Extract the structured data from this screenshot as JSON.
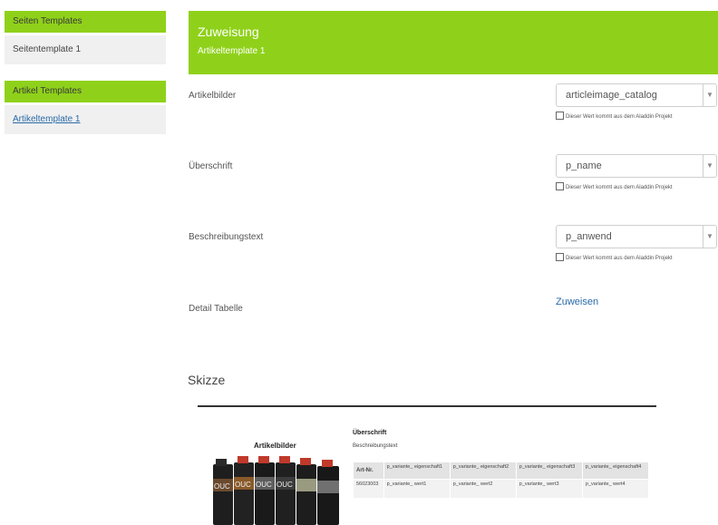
{
  "sidebar": {
    "page_templates_header": "Seiten Templates",
    "page_templates_item": "Seitentemplate 1",
    "article_templates_header": "Artikel Templates",
    "article_templates_item": "Artikeltemplate 1"
  },
  "header": {
    "title": "Zuweisung",
    "subtitle": "Artikeltemplate 1"
  },
  "fields": [
    {
      "label": "Artikelbilder",
      "value": "articleimage_catalog",
      "hint": "Dieser Wert kommt aus dem Aladdin Projekt"
    },
    {
      "label": "Überschrift",
      "value": "p_name",
      "hint": "Dieser Wert kommt aus dem Aladdin Projekt"
    },
    {
      "label": "Beschreibungstext",
      "value": "p_anwend",
      "hint": "Dieser Wert kommt aus dem Aladdin Projekt"
    }
  ],
  "detail_table": {
    "label": "Detail Tabelle",
    "link": "Zuweisen"
  },
  "sketch": {
    "title": "Skizze",
    "image_label": "Artikelbilder",
    "heading": "Überschrift",
    "description": "Beschreibungstext",
    "table": {
      "headers": [
        "Art-Nr.",
        "p_variante_ eigenschaft1",
        "p_variante_ eigenschaft2",
        "p_variante_ eigenschaft3",
        "p_variante_ eigenschaft4"
      ],
      "row": [
        "56023003",
        "p_variante_ wert1",
        "p_variante_ wert2",
        "p_variante_ wert3",
        "p_variante_ wert4"
      ]
    },
    "can_brand": "OUC"
  },
  "colors": {
    "accent": "#8fd11a",
    "link": "#2a6aa8"
  }
}
